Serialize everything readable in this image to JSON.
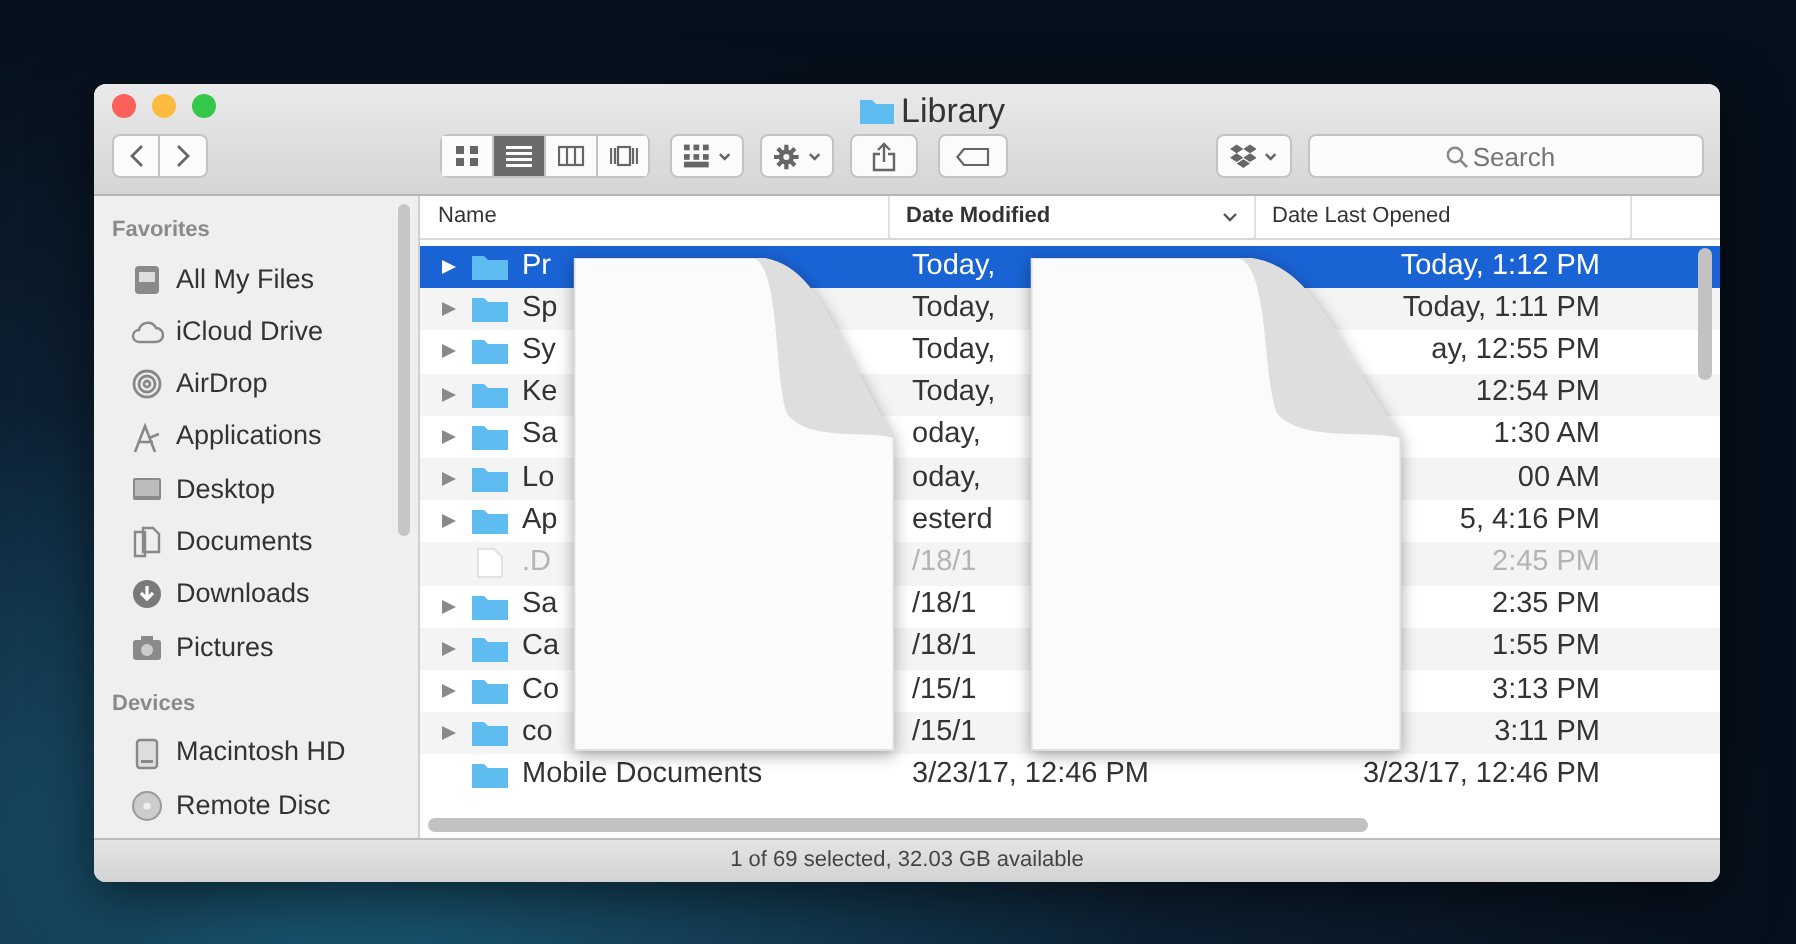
{
  "window": {
    "title": "Library"
  },
  "toolbar": {
    "view_modes": [
      {
        "kind": "icons",
        "selected": false
      },
      {
        "kind": "list",
        "selected": true
      },
      {
        "kind": "columns",
        "selected": false
      },
      {
        "kind": "cover-flow",
        "selected": false
      }
    ],
    "search": {
      "placeholder": "Search"
    }
  },
  "sidebar": [
    {
      "title": "Favorites",
      "items": [
        {
          "label": "All My Files",
          "kind": "files"
        },
        {
          "label": "iCloud Drive",
          "kind": "cloud"
        },
        {
          "label": "AirDrop",
          "kind": "airdrop"
        },
        {
          "label": "Applications",
          "kind": "apps"
        },
        {
          "label": "Desktop",
          "kind": "desktop"
        },
        {
          "label": "Documents",
          "kind": "documents"
        },
        {
          "label": "Downloads",
          "kind": "downloads"
        },
        {
          "label": "Pictures",
          "kind": "pictures"
        }
      ]
    },
    {
      "title": "Devices",
      "items": [
        {
          "label": "Macintosh HD",
          "kind": "disk"
        },
        {
          "label": "Remote Disc",
          "kind": "disc"
        }
      ]
    }
  ],
  "columns": [
    {
      "label": "Name",
      "sorted": false
    },
    {
      "label": "Date Modified",
      "sorted": true
    },
    {
      "label": "Date Last Opened",
      "sorted": false
    }
  ],
  "rows": [
    {
      "kind": "folder",
      "expandable": true,
      "selected": true,
      "dimmed": false,
      "name": "Pr",
      "date_modified": "Today,",
      "date_last_opened": "Today, 1:12 PM"
    },
    {
      "kind": "folder",
      "expandable": true,
      "selected": false,
      "dimmed": false,
      "name": "Sp",
      "date_modified": "Today,",
      "date_last_opened": "Today, 1:11 PM"
    },
    {
      "kind": "folder",
      "expandable": true,
      "selected": false,
      "dimmed": false,
      "name": "Sy",
      "date_modified": "Today,",
      "date_last_opened": "ay, 12:55 PM"
    },
    {
      "kind": "folder",
      "expandable": true,
      "selected": false,
      "dimmed": false,
      "name": "Ke",
      "date_modified": "Today,",
      "date_last_opened": "12:54 PM"
    },
    {
      "kind": "folder",
      "expandable": true,
      "selected": false,
      "dimmed": false,
      "name": "Sa",
      "date_modified": "oday,",
      "date_last_opened": "1:30 AM"
    },
    {
      "kind": "folder",
      "expandable": true,
      "selected": false,
      "dimmed": false,
      "name": "Lo",
      "date_modified": "oday,",
      "date_last_opened": "00 AM"
    },
    {
      "kind": "folder",
      "expandable": true,
      "selected": false,
      "dimmed": false,
      "name": "Ap",
      "date_modified": "esterd",
      "date_last_opened": "5, 4:16 PM"
    },
    {
      "kind": "file",
      "expandable": false,
      "selected": false,
      "dimmed": true,
      "name": ".D",
      "date_modified": "/18/1",
      "date_last_opened": "2:45 PM"
    },
    {
      "kind": "folder",
      "expandable": true,
      "selected": false,
      "dimmed": false,
      "name": "Sa",
      "date_modified": "/18/1",
      "date_last_opened": "2:35 PM"
    },
    {
      "kind": "folder",
      "expandable": true,
      "selected": false,
      "dimmed": false,
      "name": "Ca",
      "date_modified": "/18/1",
      "date_last_opened": "1:55 PM"
    },
    {
      "kind": "folder",
      "expandable": true,
      "selected": false,
      "dimmed": false,
      "name": "Co",
      "date_modified": "/15/1",
      "date_last_opened": "3:13 PM"
    },
    {
      "kind": "folder",
      "expandable": true,
      "selected": false,
      "dimmed": false,
      "name": "co",
      "date_modified": "/15/1",
      "date_last_opened": "3:11 PM"
    },
    {
      "kind": "folder",
      "expandable": false,
      "selected": false,
      "dimmed": false,
      "name": "Mobile Documents",
      "date_modified": "3/23/17, 12:46 PM",
      "date_last_opened": "3/23/17, 12:46 PM"
    }
  ],
  "status_bar": "1 of 69 selected, 32.03 GB available"
}
